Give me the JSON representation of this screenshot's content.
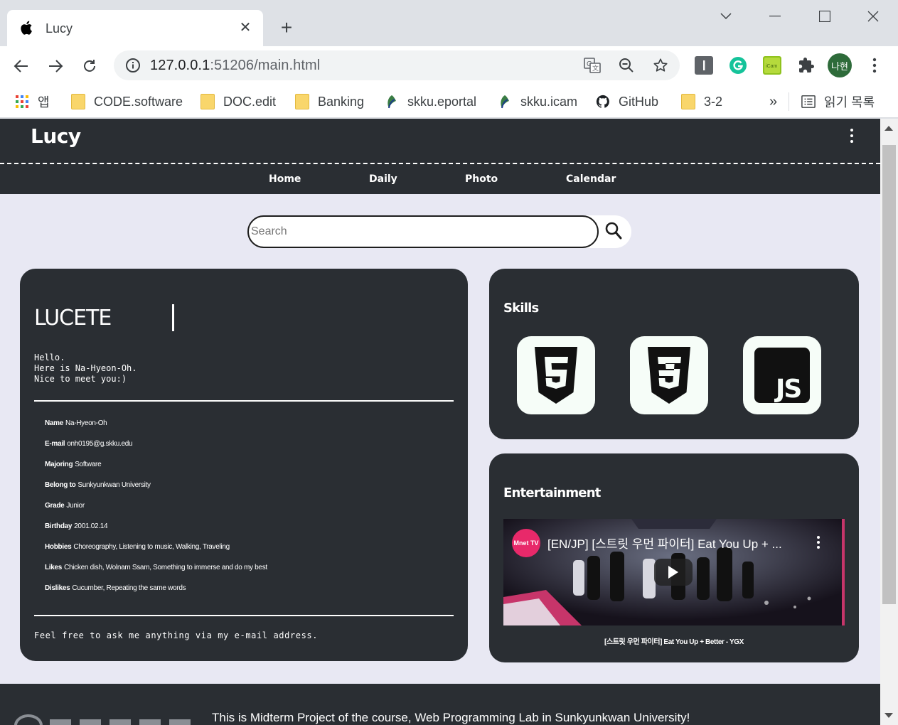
{
  "browser": {
    "tab_title": "Lucy",
    "url_host": "127.0.0.1",
    "url_rest": ":51206/main.html",
    "profile_initials": "나현",
    "bookmarks": [
      {
        "label": "앱",
        "icon": "apps-grid-icon"
      },
      {
        "label": "CODE.software",
        "icon": "folder-icon"
      },
      {
        "label": "DOC.edit",
        "icon": "folder-icon"
      },
      {
        "label": "Banking",
        "icon": "folder-icon"
      },
      {
        "label": "skku.eportal",
        "icon": "skku-leaf-icon"
      },
      {
        "label": "skku.icam",
        "icon": "skku-leaf-icon"
      },
      {
        "label": "GitHub",
        "icon": "github-icon"
      },
      {
        "label": "3-2",
        "icon": "folder-icon"
      }
    ],
    "bookmarks_overflow": "»",
    "reading_list": "읽기 목록"
  },
  "site": {
    "brand": "Lucy",
    "nav": [
      "Home",
      "Daily",
      "Photo",
      "Calendar"
    ],
    "search_placeholder": "Search"
  },
  "profile": {
    "title": "LUCETE",
    "intro": "Hello.\nHere is Na-Hyeon-Oh.\nNice to meet you:)",
    "info": [
      {
        "label": "Name",
        "value": "Na-Hyeon-Oh"
      },
      {
        "label": "E-mail",
        "value": "onh0195@g.skku.edu"
      },
      {
        "label": "Majoring",
        "value": "Software"
      },
      {
        "label": "Belong to",
        "value": "Sunkyunkwan University"
      },
      {
        "label": "Grade",
        "value": "Junior"
      },
      {
        "label": "Birthday",
        "value": "2001.02.14"
      },
      {
        "label": "Hobbies",
        "value": "Choreography, Listening to music, Walking, Traveling"
      },
      {
        "label": "Likes",
        "value": "Chicken dish, Wolnam Ssam, Something to immerse and do my best"
      },
      {
        "label": "Dislikes",
        "value": "Cucumber, Repeating the same words"
      }
    ],
    "outro": "Feel free to ask me anything via my e-mail address."
  },
  "skills": {
    "title": "Skills",
    "items": [
      "html5-icon",
      "css3-icon",
      "javascript-icon"
    ]
  },
  "entertainment": {
    "title": "Entertainment",
    "video_channel": "Mnet TV",
    "video_title": "[EN/JP] [스트릿 우먼 파이터] Eat You Up + ...",
    "caption": "[스트릿 우먼 파이터] Eat You Up + Better - YGX"
  },
  "footer": {
    "text": "This is Midterm Project of the course, Web Programming Lab in Sunkyunkwan University!"
  },
  "colors": {
    "card_bg": "#2a2e33",
    "page_bg": "#e8e8f3",
    "skill_tile": "#f6fdf8"
  }
}
